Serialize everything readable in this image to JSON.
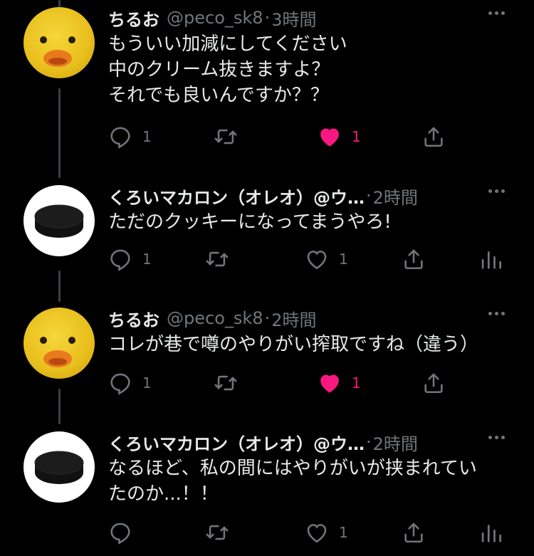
{
  "tweets": [
    {
      "name": "ちるお",
      "handle": "@peco_sk8",
      "dot": "·",
      "time": "3時間",
      "avatar": "duck-avatar",
      "text": "もういい加減にしてください\n中のクリーム抜きますよ？\nそれでも良いんですか？？",
      "reply_count": "1",
      "retweet_count": "",
      "like_count": "1",
      "liked": true,
      "has_analytics": false
    },
    {
      "name": "くろいマカロン（オレオ）@ウ…",
      "handle": "",
      "dot": "·",
      "time": "2時間",
      "avatar": "oreo-avatar",
      "text": "ただのクッキーになってまうやろ!",
      "reply_count": "1",
      "retweet_count": "",
      "like_count": "1",
      "liked": false,
      "has_analytics": true
    },
    {
      "name": "ちるお",
      "handle": "@peco_sk8",
      "dot": "·",
      "time": "2時間",
      "avatar": "duck-avatar",
      "text": "コレが巷で噂のやりがい搾取ですね（違う）",
      "reply_count": "1",
      "retweet_count": "",
      "like_count": "1",
      "liked": true,
      "has_analytics": false
    },
    {
      "name": "くろいマカロン（オレオ）@ウ…",
      "handle": "",
      "dot": "·",
      "time": "2時間",
      "avatar": "oreo-avatar",
      "text": "なるほど、私の間にはやりがいが挟まれてい\nたのか...！！",
      "reply_count": "",
      "retweet_count": "",
      "like_count": "1",
      "liked": false,
      "has_analytics": true
    }
  ],
  "colors": {
    "background": "#000000",
    "text": "#e7e9ea",
    "secondary": "#71767b",
    "like_active": "#f91880",
    "thread_line": "#3b3f44"
  },
  "icons": [
    "reply-icon",
    "retweet-icon",
    "like-icon",
    "share-icon",
    "analytics-icon",
    "more-icon"
  ]
}
